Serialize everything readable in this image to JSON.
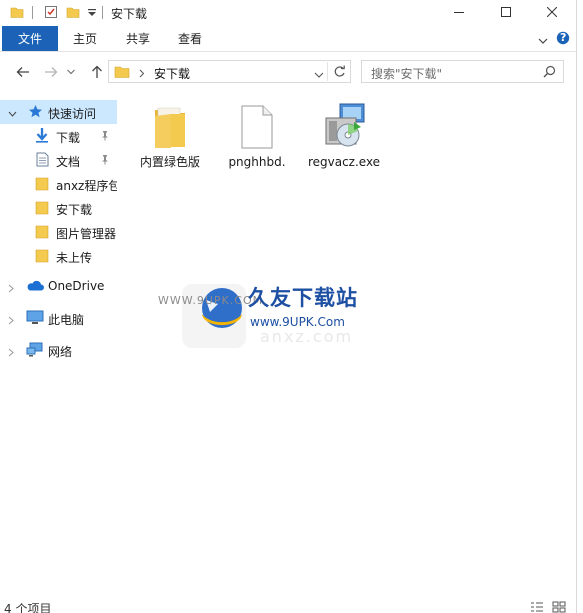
{
  "window": {
    "title": "安下载",
    "controls": [
      "minimize",
      "maximize",
      "close"
    ]
  },
  "ribbon": {
    "tabs": [
      "文件",
      "主页",
      "共享",
      "查看"
    ],
    "help": "?"
  },
  "addressbar": {
    "crumb": "安下载",
    "search_placeholder": "搜索\"安下载\""
  },
  "sidebar": {
    "quick_access": "快速访问",
    "items": [
      {
        "label": "下载",
        "icon": "download-arrow-icon",
        "pinned": true
      },
      {
        "label": "文档",
        "icon": "document-icon",
        "pinned": true
      },
      {
        "label": "anxz程序包",
        "icon": "folder-icon",
        "pinned": false
      },
      {
        "label": "安下载",
        "icon": "folder-icon",
        "pinned": false
      },
      {
        "label": "图片管理器",
        "icon": "folder-icon",
        "pinned": false
      },
      {
        "label": "未上传",
        "icon": "folder-icon",
        "pinned": false
      }
    ],
    "onedrive": "OneDrive",
    "this_pc": "此电脑",
    "network": "网络"
  },
  "files": [
    {
      "name": "内置绿色版",
      "type": "folder"
    },
    {
      "name": "pnghhbd.",
      "type": "blank-file"
    },
    {
      "name": "regvacz.exe",
      "type": "installer"
    }
  ],
  "status": {
    "count": "4 个项目"
  },
  "watermark": {
    "brand": "久友下载站",
    "url": "WWW.9UPK.COM",
    "url2": "www.9UPK.Com",
    "faint": "anxz.com"
  },
  "colors": {
    "accent": "#1c63b7",
    "selection": "#cce8ff",
    "folder": "#f3c94e"
  }
}
